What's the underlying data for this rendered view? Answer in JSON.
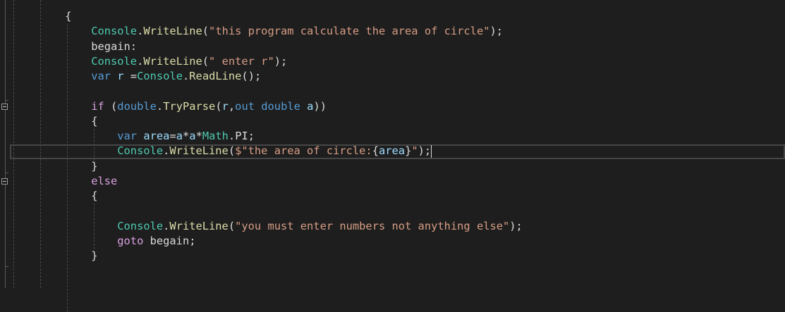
{
  "editor": {
    "current_line_index": 9,
    "lines": [
      [
        [
          "        {",
          "punct"
        ]
      ],
      [
        [
          "            ",
          "plain"
        ],
        [
          "Console",
          "class"
        ],
        [
          ".",
          "punct"
        ],
        [
          "WriteLine",
          "method"
        ],
        [
          "(",
          "punct"
        ],
        [
          "\"this program calculate the area of circle\"",
          "string"
        ],
        [
          ");",
          "punct"
        ]
      ],
      [
        [
          "            begain:",
          "plain"
        ]
      ],
      [
        [
          "            ",
          "plain"
        ],
        [
          "Console",
          "class"
        ],
        [
          ".",
          "punct"
        ],
        [
          "WriteLine",
          "method"
        ],
        [
          "(",
          "punct"
        ],
        [
          "\" enter r\"",
          "string"
        ],
        [
          ");",
          "punct"
        ]
      ],
      [
        [
          "            ",
          "plain"
        ],
        [
          "var",
          "kw"
        ],
        [
          " ",
          "plain"
        ],
        [
          "r",
          "var"
        ],
        [
          " =",
          "punct"
        ],
        [
          "Console",
          "class"
        ],
        [
          ".",
          "punct"
        ],
        [
          "ReadLine",
          "method"
        ],
        [
          "();",
          "punct"
        ]
      ],
      [],
      [
        [
          "            ",
          "plain"
        ],
        [
          "if",
          "ctrl"
        ],
        [
          " (",
          "punct"
        ],
        [
          "double",
          "kw"
        ],
        [
          ".",
          "punct"
        ],
        [
          "TryParse",
          "method"
        ],
        [
          "(",
          "punct"
        ],
        [
          "r",
          "var"
        ],
        [
          ",",
          "punct"
        ],
        [
          "out",
          "kw"
        ],
        [
          " ",
          "plain"
        ],
        [
          "double",
          "kw"
        ],
        [
          " ",
          "plain"
        ],
        [
          "a",
          "var"
        ],
        [
          "))",
          "punct"
        ]
      ],
      [
        [
          "            {",
          "punct"
        ]
      ],
      [
        [
          "                ",
          "plain"
        ],
        [
          "var",
          "kw"
        ],
        [
          " ",
          "plain"
        ],
        [
          "area",
          "var"
        ],
        [
          "=",
          "punct"
        ],
        [
          "a",
          "var"
        ],
        [
          "*",
          "punct"
        ],
        [
          "a",
          "var"
        ],
        [
          "*",
          "punct"
        ],
        [
          "Math",
          "class"
        ],
        [
          ".PI;",
          "punct"
        ]
      ],
      [
        [
          "                ",
          "plain"
        ],
        [
          "Console",
          "class"
        ],
        [
          ".",
          "punct"
        ],
        [
          "WriteLine",
          "method"
        ],
        [
          "(",
          "punct"
        ],
        [
          "$\"the area of circle:",
          "string"
        ],
        [
          "{",
          "punct"
        ],
        [
          "area",
          "var"
        ],
        [
          "}",
          "punct"
        ],
        [
          "\"",
          "string"
        ],
        [
          ");",
          "punct"
        ]
      ],
      [
        [
          "            }",
          "punct"
        ]
      ],
      [
        [
          "            ",
          "plain"
        ],
        [
          "else",
          "ctrl"
        ]
      ],
      [
        [
          "            {",
          "punct"
        ]
      ],
      [],
      [
        [
          "                ",
          "plain"
        ],
        [
          "Console",
          "class"
        ],
        [
          ".",
          "punct"
        ],
        [
          "WriteLine",
          "method"
        ],
        [
          "(",
          "punct"
        ],
        [
          "\"you must enter numbers not anything else\"",
          "string"
        ],
        [
          ");",
          "punct"
        ]
      ],
      [
        [
          "                ",
          "plain"
        ],
        [
          "goto",
          "ctrl"
        ],
        [
          " begain;",
          "plain"
        ]
      ],
      [
        [
          "            }",
          "punct"
        ]
      ]
    ]
  }
}
